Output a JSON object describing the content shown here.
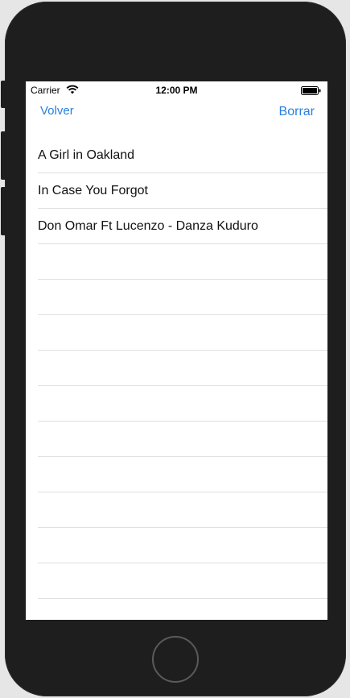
{
  "status_bar": {
    "carrier": "Carrier",
    "time": "12:00 PM",
    "icons": [
      "wifi-icon",
      "battery-icon"
    ]
  },
  "nav": {
    "left_button": "Volver",
    "right_button": "Borrar",
    "accent_color": "#2a7fdc"
  },
  "list": {
    "items": [
      {
        "label": "A Girl in Oakland"
      },
      {
        "label": "In Case You Forgot"
      },
      {
        "label": "Don Omar Ft Lucenzo - Danza Kuduro"
      },
      {
        "label": ""
      },
      {
        "label": ""
      },
      {
        "label": ""
      },
      {
        "label": ""
      },
      {
        "label": ""
      },
      {
        "label": ""
      },
      {
        "label": ""
      },
      {
        "label": ""
      },
      {
        "label": ""
      },
      {
        "label": ""
      },
      {
        "label": ""
      }
    ]
  }
}
